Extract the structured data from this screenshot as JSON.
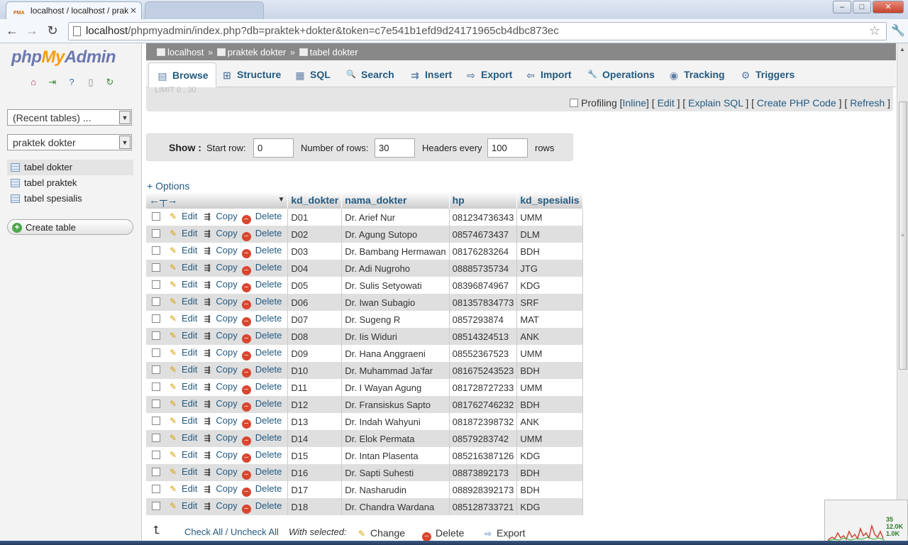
{
  "browser": {
    "tabs": [
      {
        "title": "localhost / localhost / prak",
        "favicon": "PMA"
      },
      {
        "title": ""
      }
    ],
    "url_host": "localhost",
    "url_path": "/phpmyadmin/index.php?db=praktek+dokter&token=c7e541b1efd9d24171965cb4dbc873ec",
    "window_buttons": {
      "minimize": "–",
      "maximize": "□",
      "close": "✕"
    }
  },
  "sidebar": {
    "logo": {
      "php": "php",
      "my": "My",
      "admin": "Admin"
    },
    "icons": [
      "home-icon",
      "exit-icon",
      "help-icon",
      "docs-icon",
      "reload-icon"
    ],
    "recent_select": "(Recent tables) ...",
    "db_select": "praktek dokter",
    "tables": [
      "tabel dokter",
      "tabel praktek",
      "tabel spesialis"
    ],
    "create_table": "Create table"
  },
  "breadcrumb": {
    "server": "localhost",
    "database": "praktek dokter",
    "table": "tabel dokter",
    "separator": "»"
  },
  "tabs": [
    {
      "label": "Browse",
      "icon": "browse-icon",
      "glyph": "▤"
    },
    {
      "label": "Structure",
      "icon": "structure-icon",
      "glyph": "⊞"
    },
    {
      "label": "SQL",
      "icon": "sql-icon",
      "glyph": "▦"
    },
    {
      "label": "Search",
      "icon": "search-icon",
      "glyph": "🔍"
    },
    {
      "label": "Insert",
      "icon": "insert-icon",
      "glyph": "⇉"
    },
    {
      "label": "Export",
      "icon": "export-icon",
      "glyph": "⇨"
    },
    {
      "label": "Import",
      "icon": "import-icon",
      "glyph": "⇦"
    },
    {
      "label": "Operations",
      "icon": "operations-icon",
      "glyph": "🔧"
    },
    {
      "label": "Tracking",
      "icon": "tracking-icon",
      "glyph": "◉"
    },
    {
      "label": "Triggers",
      "icon": "triggers-icon",
      "glyph": "⚙"
    }
  ],
  "sql_bar": {
    "faded_text": "LIMIT 0 , 30",
    "profiling": "Profiling",
    "inline": "Inline",
    "edit": "Edit",
    "explain": "Explain SQL",
    "create_php": "Create PHP Code",
    "refresh": "Refresh"
  },
  "show_bar": {
    "show": "Show :",
    "start_row_label": "Start row:",
    "start_row": "0",
    "num_rows_label": "Number of rows:",
    "num_rows": "30",
    "headers_every_label": "Headers every",
    "headers_every": "100",
    "rows": "rows"
  },
  "options_link": "+ Options",
  "table": {
    "columns": [
      "kd_dokter",
      "nama_dokter",
      "hp",
      "kd_spesialis"
    ],
    "actions": {
      "edit": "Edit",
      "copy": "Copy",
      "delete": "Delete"
    },
    "rows": [
      [
        "D01",
        "Dr. Arief Nur",
        "081234736343",
        "UMM"
      ],
      [
        "D02",
        "Dr. Agung Sutopo",
        "08574673437",
        "DLM"
      ],
      [
        "D03",
        "Dr. Bambang Hermawan",
        "08176283264",
        "BDH"
      ],
      [
        "D04",
        "Dr. Adi Nugroho",
        "08885735734",
        "JTG"
      ],
      [
        "D05",
        "Dr. Sulis Setyowati",
        "08396874967",
        "KDG"
      ],
      [
        "D06",
        "Dr. Iwan Subagio",
        "081357834773",
        "SRF"
      ],
      [
        "D07",
        "Dr. Sugeng R",
        "0857293874",
        "MAT"
      ],
      [
        "D08",
        "Dr. Iis Widuri",
        "08514324513",
        "ANK"
      ],
      [
        "D09",
        "Dr. Hana Anggraeni",
        "08552367523",
        "UMM"
      ],
      [
        "D10",
        "Dr. Muhammad Ja'far",
        "081675243523",
        "BDH"
      ],
      [
        "D11",
        "Dr. I Wayan Agung",
        "081728727233",
        "UMM"
      ],
      [
        "D12",
        "Dr. Fransiskus Sapto",
        "081762746232",
        "BDH"
      ],
      [
        "D13",
        "Dr. Indah Wahyuni",
        "081872398732",
        "ANK"
      ],
      [
        "D14",
        "Dr. Elok Permata",
        "08579283742",
        "UMM"
      ],
      [
        "D15",
        "Dr. Intan Plasenta",
        "085216387126",
        "KDG"
      ],
      [
        "D16",
        "Dr. Sapti Suhesti",
        "08873892173",
        "BDH"
      ],
      [
        "D17",
        "Dr. Nasharudin",
        "088928392173",
        "BDH"
      ],
      [
        "D18",
        "Dr. Chandra Wardana",
        "085128733721",
        "KDG"
      ]
    ]
  },
  "bottom": {
    "check_all": "Check All / Uncheck All",
    "with_selected": "With selected:",
    "change": "Change",
    "delete": "Delete",
    "export": "Export"
  },
  "meter": {
    "stats": [
      "35",
      "12.0K",
      "1.0K"
    ]
  },
  "colors": {
    "link": "#235a81",
    "breadcrumb_bg": "#888888",
    "logo_blue": "#6c78af",
    "logo_orange": "#f89c0e"
  }
}
